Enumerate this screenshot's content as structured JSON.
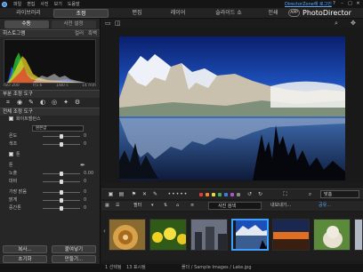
{
  "window": {
    "dz_link": "DirectorZone에 로그인",
    "buttons": [
      "?",
      "–",
      "□",
      "✕"
    ]
  },
  "menu": [
    "파일",
    "편집",
    "사진",
    "보기",
    "도움말"
  ],
  "modules": {
    "library": "라이브러리",
    "adjust": "조정",
    "edit": "편집",
    "layer": "레이어",
    "slideshow": "슬라이드 쇼",
    "print": "인쇄",
    "app": "APP",
    "brand": "PhotoDirector"
  },
  "left": {
    "tabs": [
      "수동",
      "사전 설정"
    ],
    "histogram": {
      "title": "히스토그램",
      "right": [
        "컬러",
        "흑백"
      ]
    },
    "exif": [
      "ISO 200",
      "f/5.6",
      "1/80 s",
      "14 mm"
    ],
    "region_tools": "부분 조정 도구",
    "global_tools": "전체 조정 도구",
    "white_balance": {
      "label": "화이트밸런스",
      "preset": "원본값",
      "rows": [
        {
          "label": "온도",
          "value": "0"
        },
        {
          "label": "색조",
          "value": "0"
        }
      ]
    },
    "tone": {
      "label": "톤",
      "rows": [
        {
          "label": "톤",
          "value": ""
        },
        {
          "label": "노출",
          "value": "0.00"
        },
        {
          "label": "대비",
          "value": "0"
        },
        {
          "label": "가장 밝음",
          "value": "0"
        },
        {
          "label": "밝게",
          "value": "0"
        },
        {
          "label": "중간톤",
          "value": "0"
        }
      ]
    },
    "buttons": {
      "copy": "복사...",
      "paste": "붙여넣기",
      "reset": "초기화",
      "snapshot": "만들기..."
    }
  },
  "filmbar": {
    "filter": "필터",
    "search": "사진 검색",
    "import": "내보내기...",
    "share": "공유..."
  },
  "zoom": "맞춤",
  "colors": [
    "#e23b3b",
    "#f08a1e",
    "#e8d84a",
    "#3fb04f",
    "#3a7fe0",
    "#b44ed8",
    "#8a8a8a"
  ],
  "status": {
    "selected": "1 선택됨",
    "total": "13 표시됨",
    "path": "폴더 / Sample Images / Lake.jpg"
  }
}
